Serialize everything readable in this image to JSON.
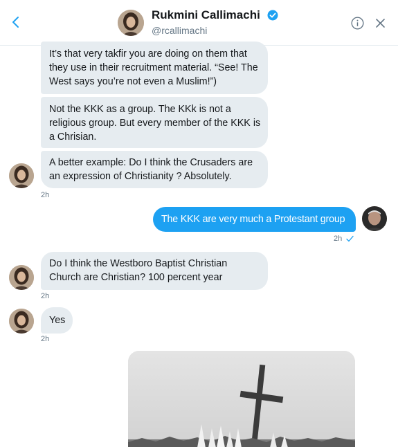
{
  "header": {
    "name": "Rukmini Callimachi",
    "handle": "@rcallimachi"
  },
  "messages": [
    {
      "lines": [
        "It’s that very takfir you are doing on them that",
        "they use in their recruitment material. “See! The",
        "West says you’re not even a Muslim!”)"
      ]
    },
    {
      "lines": [
        "Not the KKK as a group. The KKk is not a",
        "religious group. But every member of the KKK is",
        "a Chrisian."
      ]
    },
    {
      "lines": [
        "A better example: Do I think the Crusaders are",
        "an expression of Christianity ? Absolutely."
      ],
      "time": "2h"
    },
    {
      "outgoing": true,
      "lines": [
        "The KKK are very much a Protestant group"
      ],
      "time": "2h"
    },
    {
      "lines": [
        "Do I think the Westboro Baptist Christian",
        "Church are Christian? 100 percent year"
      ],
      "time": "2h"
    },
    {
      "lines": [
        "Yes"
      ],
      "time": "2h"
    }
  ],
  "colors": {
    "accent": "#1da1f2",
    "incoming_bubble": "#e6ecf0",
    "muted_text": "#657786"
  }
}
